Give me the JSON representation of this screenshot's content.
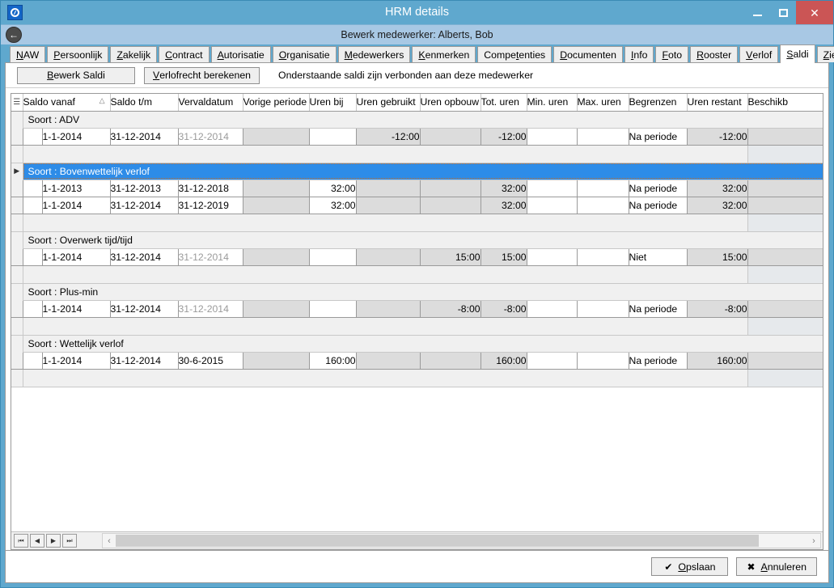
{
  "window": {
    "title": "HRM details",
    "app_icon": "circle-app-icon",
    "controls": {
      "minimize": "minimize-icon",
      "maximize": "maximize-icon",
      "close": "close-icon",
      "close_label": "✕"
    }
  },
  "subheader": {
    "back_icon": "⬅",
    "title": "Bewerk medewerker: Alberts, Bob"
  },
  "tabs": [
    {
      "label": "NAW",
      "mnemonic": "N",
      "active": false
    },
    {
      "label": "Persoonlijk",
      "mnemonic": "P",
      "active": false
    },
    {
      "label": "Zakelijk",
      "mnemonic": "Z",
      "active": false
    },
    {
      "label": "Contract",
      "mnemonic": "C",
      "active": false
    },
    {
      "label": "Autorisatie",
      "mnemonic": "A",
      "active": false
    },
    {
      "label": "Organisatie",
      "mnemonic": "O",
      "active": false
    },
    {
      "label": "Medewerkers",
      "mnemonic": "M",
      "active": false
    },
    {
      "label": "Kenmerken",
      "mnemonic": "K",
      "active": false
    },
    {
      "label": "Competenties",
      "mnemonic": "t",
      "active": false
    },
    {
      "label": "Documenten",
      "mnemonic": "D",
      "active": false
    },
    {
      "label": "Info",
      "mnemonic": "I",
      "active": false
    },
    {
      "label": "Foto",
      "mnemonic": "F",
      "active": false
    },
    {
      "label": "Rooster",
      "mnemonic": "R",
      "active": false
    },
    {
      "label": "Verlof",
      "mnemonic": "V",
      "active": false
    },
    {
      "label": "Saldi",
      "mnemonic": "S",
      "active": true
    },
    {
      "label": "Ziekte",
      "mnemonic": "Z",
      "active": false
    }
  ],
  "toolbar": {
    "bewerk_saldi_label": "Bewerk Saldi",
    "bewerk_saldi_mnemonic": "B",
    "verlofrecht_label": "Verlofrecht berekenen",
    "verlofrecht_mnemonic": "V",
    "note": "Onderstaande saldi zijn verbonden aan deze medewerker"
  },
  "grid": {
    "columns": [
      "Saldo vanaf",
      "Saldo t/m",
      "Vervaldatum",
      "Vorige periode",
      "Uren bij",
      "Uren gebruikt",
      "Uren opbouw",
      "Tot. uren",
      "Min. uren",
      "Max. uren",
      "Begrenzen",
      "Uren restant",
      "Beschikb"
    ],
    "sort_column": "Saldo vanaf",
    "sort_indicator": "△",
    "groups": [
      {
        "label": "Soort : ADV",
        "selected": false,
        "rows": [
          {
            "saldo_vanaf": "1-1-2014",
            "saldo_tm": "31-12-2014",
            "vervaldatum": "31-12-2014",
            "vervaldatum_muted": true,
            "vorige_periode": "",
            "uren_bij": "",
            "uren_gebruikt": "-12:00",
            "uren_opbouw": "",
            "tot_uren": "-12:00",
            "min_uren": "",
            "max_uren": "",
            "begrenzen": "Na periode",
            "uren_restant": "-12:00",
            "beschikb": ""
          }
        ]
      },
      {
        "label": "Soort : Bovenwettelijk verlof",
        "selected": true,
        "rows": [
          {
            "saldo_vanaf": "1-1-2013",
            "saldo_tm": "31-12-2013",
            "vervaldatum": "31-12-2018",
            "vervaldatum_muted": false,
            "vorige_periode": "",
            "uren_bij": "32:00",
            "uren_gebruikt": "",
            "uren_opbouw": "",
            "tot_uren": "32:00",
            "min_uren": "",
            "max_uren": "",
            "begrenzen": "Na periode",
            "uren_restant": "32:00",
            "beschikb": ""
          },
          {
            "saldo_vanaf": "1-1-2014",
            "saldo_tm": "31-12-2014",
            "vervaldatum": "31-12-2019",
            "vervaldatum_muted": false,
            "vorige_periode": "",
            "uren_bij": "32:00",
            "uren_gebruikt": "",
            "uren_opbouw": "",
            "tot_uren": "32:00",
            "min_uren": "",
            "max_uren": "",
            "begrenzen": "Na periode",
            "uren_restant": "32:00",
            "beschikb": ""
          }
        ]
      },
      {
        "label": "Soort : Overwerk tijd/tijd",
        "selected": false,
        "rows": [
          {
            "saldo_vanaf": "1-1-2014",
            "saldo_tm": "31-12-2014",
            "vervaldatum": "31-12-2014",
            "vervaldatum_muted": true,
            "vorige_periode": "",
            "uren_bij": "",
            "uren_gebruikt": "",
            "uren_opbouw": "15:00",
            "tot_uren": "15:00",
            "min_uren": "",
            "max_uren": "",
            "begrenzen": "Niet",
            "uren_restant": "15:00",
            "beschikb": ""
          }
        ]
      },
      {
        "label": "Soort : Plus-min",
        "selected": false,
        "rows": [
          {
            "saldo_vanaf": "1-1-2014",
            "saldo_tm": "31-12-2014",
            "vervaldatum": "31-12-2014",
            "vervaldatum_muted": true,
            "vorige_periode": "",
            "uren_bij": "",
            "uren_gebruikt": "",
            "uren_opbouw": "-8:00",
            "tot_uren": "-8:00",
            "min_uren": "",
            "max_uren": "",
            "begrenzen": "Na periode",
            "uren_restant": "-8:00",
            "beschikb": ""
          }
        ]
      },
      {
        "label": "Soort : Wettelijk verlof",
        "selected": false,
        "rows": [
          {
            "saldo_vanaf": "1-1-2014",
            "saldo_tm": "31-12-2014",
            "vervaldatum": "30-6-2015",
            "vervaldatum_muted": false,
            "vorige_periode": "",
            "uren_bij": "160:00",
            "uren_gebruikt": "",
            "uren_opbouw": "",
            "tot_uren": "160:00",
            "min_uren": "",
            "max_uren": "",
            "begrenzen": "Na periode",
            "uren_restant": "160:00",
            "beschikb": ""
          }
        ]
      }
    ]
  },
  "gridnav": {
    "first": "⏮",
    "prev": "◀",
    "next": "▶",
    "last": "⏭",
    "scroll_left": "‹",
    "scroll_right": "›"
  },
  "footer": {
    "save_label": "Opslaan",
    "save_mnemonic": "O",
    "save_icon": "✔",
    "cancel_label": "Annuleren",
    "cancel_mnemonic": "A",
    "cancel_icon": "✖"
  }
}
